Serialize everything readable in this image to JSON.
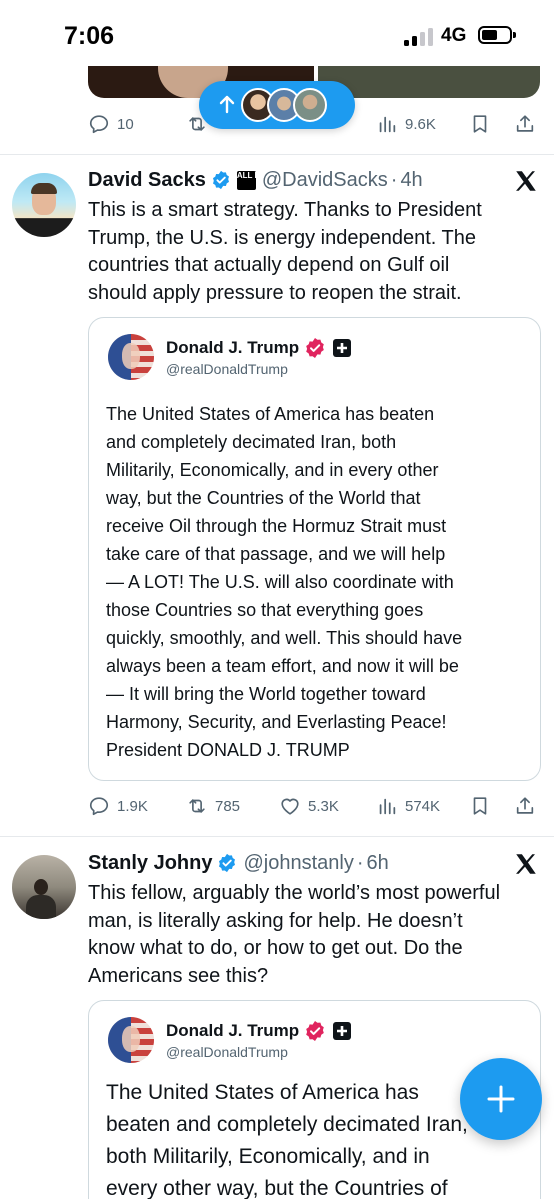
{
  "status_bar": {
    "time": "7:06",
    "network": "4G"
  },
  "prev_tweet": {
    "replies": "10",
    "views": "9.6K"
  },
  "tweets": [
    {
      "name": "David Sacks",
      "affiliate_badge": "ALL IN",
      "handle": "@DavidSacks",
      "time": "4h",
      "lines": [
        "This is a smart strategy. Thanks to President",
        "Trump, the U.S. is energy independent. The",
        "countries that actually depend on Gulf oil",
        "should apply pressure to reopen the strait."
      ],
      "quote": {
        "name": "Donald J. Trump",
        "handle": "@realDonaldTrump",
        "lines": [
          "The United States of America has beaten",
          "and completely decimated Iran, both",
          "Militarily, Economically, and in every other",
          "way, but the Countries of the World that",
          "receive Oil through the Hormuz Strait must",
          "take care of that passage, and we will help",
          "— A LOT! The U.S. will also coordinate with",
          "those Countries so that everything goes",
          "quickly, smoothly, and well. This should have",
          "always been a team effort, and now it will be",
          "— It will bring the World together toward",
          "Harmony, Security, and Everlasting Peace!",
          "President DONALD J. TRUMP"
        ]
      },
      "actions": {
        "replies": "1.9K",
        "reposts": "785",
        "likes": "5.3K",
        "views": "574K"
      }
    },
    {
      "name": "Stanly Johny",
      "handle": "@johnstanly",
      "time": "6h",
      "lines": [
        "This fellow, arguably the world’s most powerful",
        "man, is literally asking for help. He doesn’t",
        "know what to do, or how to get out. Do the",
        "Americans see this?"
      ],
      "quote": {
        "name": "Donald J. Trump",
        "handle": "@realDonaldTrump",
        "lines": [
          "The United States of America has",
          "beaten and completely decimated Iran,",
          "both Militarily, Economically, and in",
          "every other way, but the Countries of"
        ]
      }
    }
  ],
  "colors": {
    "accent": "#1d9bf0",
    "text": "#0f1419",
    "muted": "#536471",
    "border": "#cfd9de"
  },
  "icons": {
    "scroll_top": "arrow-up-icon",
    "verified": "verified-badge-icon",
    "platform": "x-logo-icon",
    "compose": "plus-icon"
  }
}
